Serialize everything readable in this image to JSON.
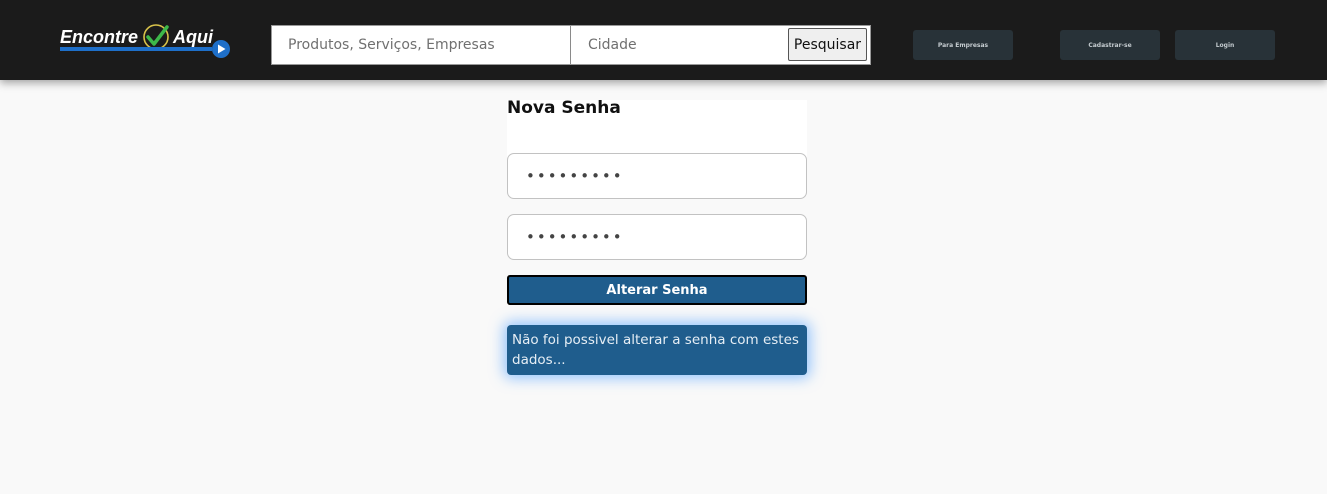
{
  "header": {
    "logo": {
      "text_left": "Encontre",
      "text_right": "Aqui",
      "check_icon": "check-circle-icon",
      "play_icon": "play-circle-icon"
    },
    "search": {
      "product_placeholder": "Produtos, Serviços, Empresas",
      "city_placeholder": "Cidade",
      "button_label": "Pesquisar"
    },
    "nav": {
      "business_label": "Para Empresas",
      "signup_label": "Cadastrar-se",
      "login_label": "Login"
    }
  },
  "form": {
    "title": "Nova Senha",
    "password_value": "•••••••••",
    "confirm_value": "•••••••••",
    "submit_label": "Alterar Senha",
    "error_message": "Não foi possivel alterar a senha com estes dados..."
  },
  "colors": {
    "header_bg": "#1b1b1b",
    "nav_button_bg": "#283238",
    "primary": "#1f5d8d",
    "logo_blue": "#1e6fc9",
    "logo_green": "#3db84a"
  }
}
